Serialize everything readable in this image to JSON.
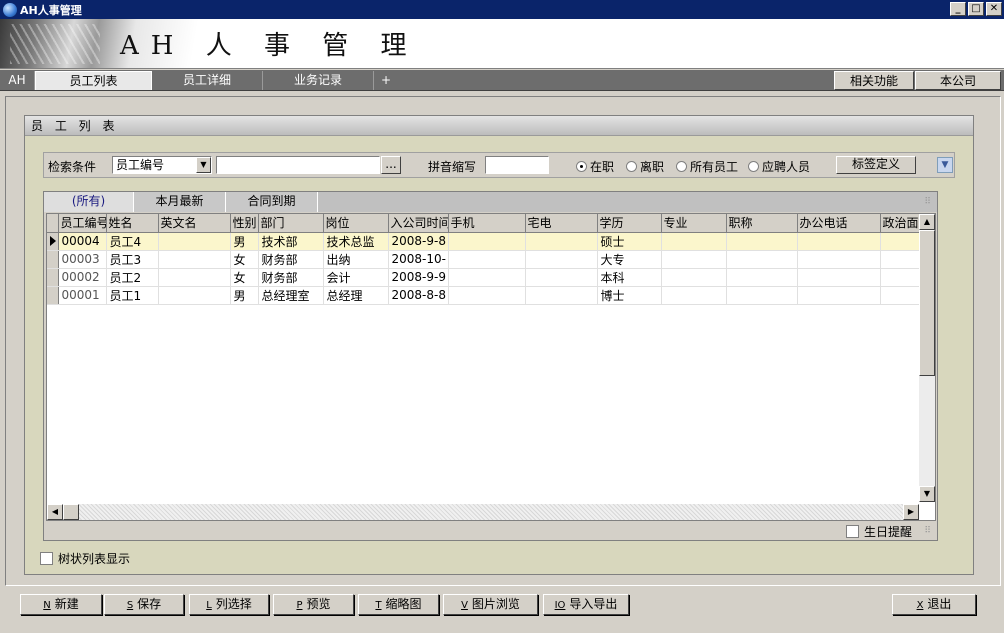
{
  "window": {
    "title": "AH人事管理"
  },
  "banner": {
    "heading": "AH 人 事 管 理"
  },
  "nav": {
    "brand": "AH",
    "tabs": [
      "员工列表",
      "员工详细",
      "业务记录",
      "+"
    ],
    "right": [
      "相关功能",
      "本公司"
    ]
  },
  "panel": {
    "title": "员 工 列 表"
  },
  "search": {
    "label": "检索条件",
    "field_selected": "员工编号",
    "browse_label": "...",
    "pinyin_label": "拼音缩写",
    "radios": [
      "在职",
      "离职",
      "所有员工",
      "应聘人员"
    ],
    "radio_selected": 0,
    "tag_button": "标签定义"
  },
  "subtabs": [
    "(所有)",
    "本月最新",
    "合同到期"
  ],
  "table": {
    "columns": [
      "员工编号",
      "姓名",
      "英文名",
      "性别",
      "部门",
      "岗位",
      "入公司时间",
      "手机",
      "宅电",
      "学历",
      "专业",
      "职称",
      "办公电话",
      "政治面貌"
    ],
    "rows": [
      [
        "00004",
        "员工4",
        "",
        "男",
        "技术部",
        "技术总监",
        "2008-9-8",
        "",
        "",
        "硕士",
        "",
        "",
        "",
        ""
      ],
      [
        "00003",
        "员工3",
        "",
        "女",
        "财务部",
        "出纳",
        "2008-10-",
        "",
        "",
        "大专",
        "",
        "",
        "",
        ""
      ],
      [
        "00002",
        "员工2",
        "",
        "女",
        "财务部",
        "会计",
        "2008-9-9",
        "",
        "",
        "本科",
        "",
        "",
        "",
        ""
      ],
      [
        "00001",
        "员工1",
        "",
        "男",
        "总经理室",
        "总经理",
        "2008-8-8",
        "",
        "",
        "博士",
        "",
        "",
        "",
        ""
      ]
    ],
    "selected_row": 0
  },
  "options": {
    "birthday_reminder": "生日提醒",
    "tree_view": "树状列表显示"
  },
  "buttons": [
    {
      "key": "N",
      "label": "新建"
    },
    {
      "key": "S",
      "label": "保存"
    },
    {
      "key": "L",
      "label": "列选择"
    },
    {
      "key": "P",
      "label": "预览"
    },
    {
      "key": "T",
      "label": "缩略图"
    },
    {
      "key": "V",
      "label": "图片浏览"
    },
    {
      "key": "IO",
      "label": "导入导出"
    },
    {
      "key": "X",
      "label": "退出"
    }
  ],
  "colors": {
    "titlebar": "#0a246a",
    "panel": "#d8d7bd",
    "selected_row": "#fbf6cc",
    "navbar": "#6d6d6d"
  }
}
